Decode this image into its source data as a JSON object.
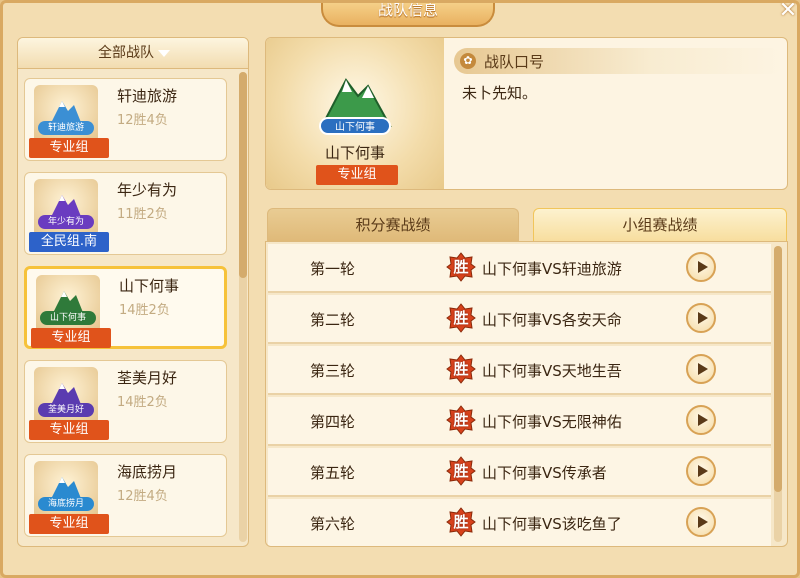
{
  "window": {
    "title": "战队信息",
    "close_icon": "close-icon"
  },
  "team_list": {
    "filter_label": "全部战队",
    "teams": [
      {
        "name": "轩迪旅游",
        "record": "12胜4负",
        "group": "专业组",
        "emblem_text": "轩迪旅游",
        "emblem_color": "#3b8fd4",
        "group_color": "#e0531b"
      },
      {
        "name": "年少有为",
        "record": "11胜2负",
        "group": "全民组.南",
        "emblem_text": "年少有为",
        "emblem_color": "#6a3cc0",
        "group_color": "#2d62c9"
      },
      {
        "name": "山下何事",
        "record": "14胜2负",
        "group": "专业组",
        "emblem_text": "山下何事",
        "emblem_color": "#2f7a3a",
        "group_color": "#e0531b",
        "selected": true
      },
      {
        "name": "荃美月好",
        "record": "14胜2负",
        "group": "专业组",
        "emblem_text": "荃美月好",
        "emblem_color": "#5a3cb0",
        "group_color": "#e0531b"
      },
      {
        "name": "海底捞月",
        "record": "12胜4负",
        "group": "专业组",
        "emblem_text": "海底捞月",
        "emblem_color": "#2a8ad0",
        "group_color": "#e0531b"
      }
    ]
  },
  "detail": {
    "team_name": "山下何事",
    "group": "专业组",
    "emblem_text": "山下何事",
    "slogan_title": "战队口号",
    "slogan": "未卜先知。"
  },
  "tabs": {
    "points": "积分赛战绩",
    "group_stage": "小组赛战绩",
    "active": "group_stage"
  },
  "results": {
    "win_label": "胜",
    "rows": [
      {
        "round": "第一轮",
        "match": "山下何事VS轩迪旅游"
      },
      {
        "round": "第二轮",
        "match": "山下何事VS各安天命"
      },
      {
        "round": "第三轮",
        "match": "山下何事VS天地生吾"
      },
      {
        "round": "第四轮",
        "match": "山下何事VS无限神佑"
      },
      {
        "round": "第五轮",
        "match": "山下何事VS传承者"
      },
      {
        "round": "第六轮",
        "match": "山下何事VS该吃鱼了"
      }
    ]
  },
  "colors": {
    "win_red": "#d8421c",
    "pro_badge": "#e0531b",
    "public_badge": "#2d62c9",
    "selected_border": "#f6c23a"
  }
}
